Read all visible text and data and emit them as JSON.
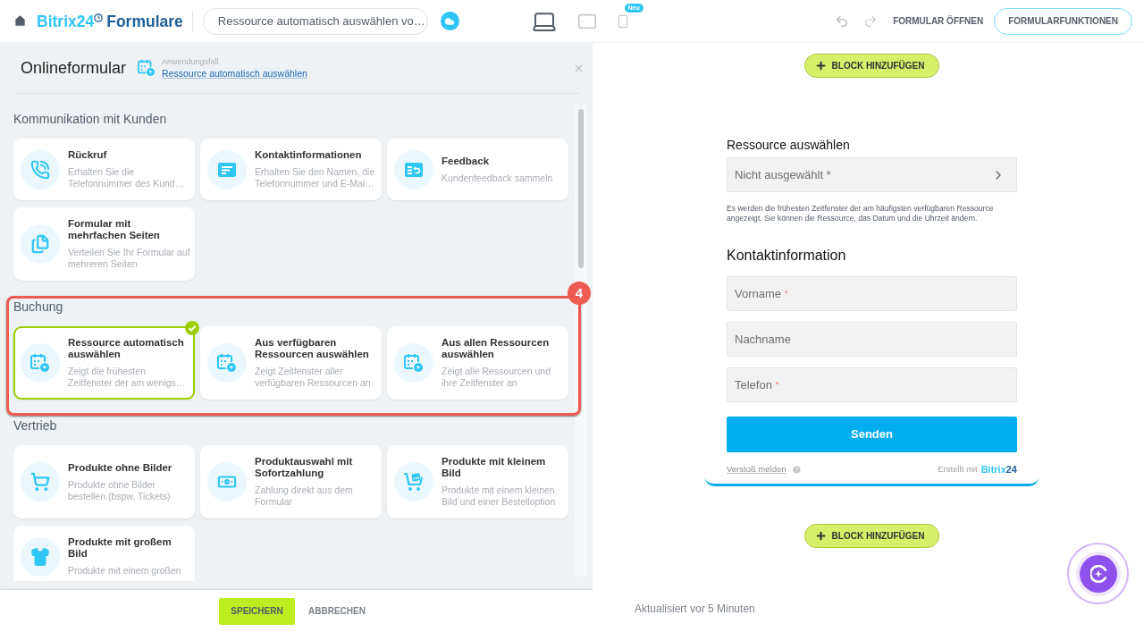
{
  "topbar": {
    "logo": {
      "brand": "Bitrix24",
      "product": "Formulare"
    },
    "form_selector": "Ressource automatisch auswählen vo…",
    "devices": [
      {
        "kind": "laptop",
        "selected": true
      },
      {
        "kind": "tablet",
        "selected": false
      },
      {
        "kind": "phone",
        "selected": false,
        "badge": "Neu"
      }
    ],
    "open_form": "FORMULAR ÖFFNEN",
    "form_features": "FORMULARFUNKTIONEN"
  },
  "panel": {
    "title": "Onlineformular",
    "use_case_label": "Anwendungsfall",
    "use_case_link": "Ressource automatisch auswählen",
    "sections": [
      {
        "title": "Kommunikation mit Kunden",
        "items": [
          {
            "kind": "callback",
            "title": "Rückruf",
            "description": "Erhalten Sie die Telefonnummer des Kund…",
            "selected": false
          },
          {
            "kind": "contact",
            "title": "Kontaktinformationen",
            "description": "Erhalten Sie den Namen, die Telefonnummer und E-Mai…",
            "selected": false
          },
          {
            "kind": "feedback",
            "title": "Feedback",
            "description": "Kundenfeedback sammeln",
            "selected": false
          },
          {
            "kind": "multipage",
            "title": "Formular mit mehrfachen Seiten",
            "description": "Verteilen Sie Ihr Formular auf mehreren Seiten",
            "selected": false
          }
        ]
      },
      {
        "title": "Buchung",
        "callout": "4",
        "items": [
          {
            "kind": "booking",
            "title": "Ressource automatisch auswählen",
            "description": "Zeigt die frühesten Zeitfenster der am wenigs…",
            "selected": true
          },
          {
            "kind": "booking",
            "title": "Aus verfügbaren Ressourcen auswählen",
            "description": "Zeigt Zeitfenster aller verfügbaren Ressourcen an",
            "selected": false
          },
          {
            "kind": "booking",
            "title": "Aus allen Ressourcen auswählen",
            "description": "Zeigt alle Ressourcen und ihre Zeitfenster an",
            "selected": false
          }
        ]
      },
      {
        "title": "Vertrieb",
        "items": [
          {
            "kind": "tickets",
            "title": "Produkte ohne Bilder",
            "description": "Produkte ohne Bilder bestellen (bspw. Tickets)",
            "selected": false
          },
          {
            "kind": "payment",
            "title": "Produktauswahl mit Sofortzahlung",
            "description": "Zahlung direkt aus dem Formular",
            "selected": false
          },
          {
            "kind": "smallimage",
            "title": "Produkte mit kleinem Bild",
            "description": "Produkte mit einem kleinen Bild und einer Bestelloption",
            "selected": false
          },
          {
            "kind": "largeimage",
            "title": "Produkte mit großem Bild",
            "description": "Produkte mit einem großen",
            "selected": false
          }
        ]
      }
    ],
    "save": "SPEICHERN",
    "cancel": "ABBRECHEN"
  },
  "preview": {
    "add_block_top": "BLOCK HINZUFÜGEN",
    "form": {
      "resource_label": "Ressource auswählen",
      "resource_select": {
        "placeholder": "Nicht ausgewählt *"
      },
      "hint": "Es werden die frühesten Zeitfenster der am häufigsten verfügbaren Ressource angezeigt. Sie können die Ressource, das Datum und die Uhrzeit ändern.",
      "contact_heading": "Kontaktinformation",
      "fields": [
        {
          "placeholder": "Vorname",
          "required_mark": "*"
        },
        {
          "placeholder": "Nachname"
        },
        {
          "placeholder": "Telefon",
          "required_mark": "*"
        }
      ],
      "submit": "Senden",
      "report_link": "Verstoß melden",
      "credit": {
        "label": "Erstellt mit",
        "brand": "Bitrix",
        "brand_suffix": "24"
      }
    },
    "add_block_bottom": "BLOCK HINZUFÜGEN",
    "status": "Aktualisiert vor 5 Minuten"
  }
}
